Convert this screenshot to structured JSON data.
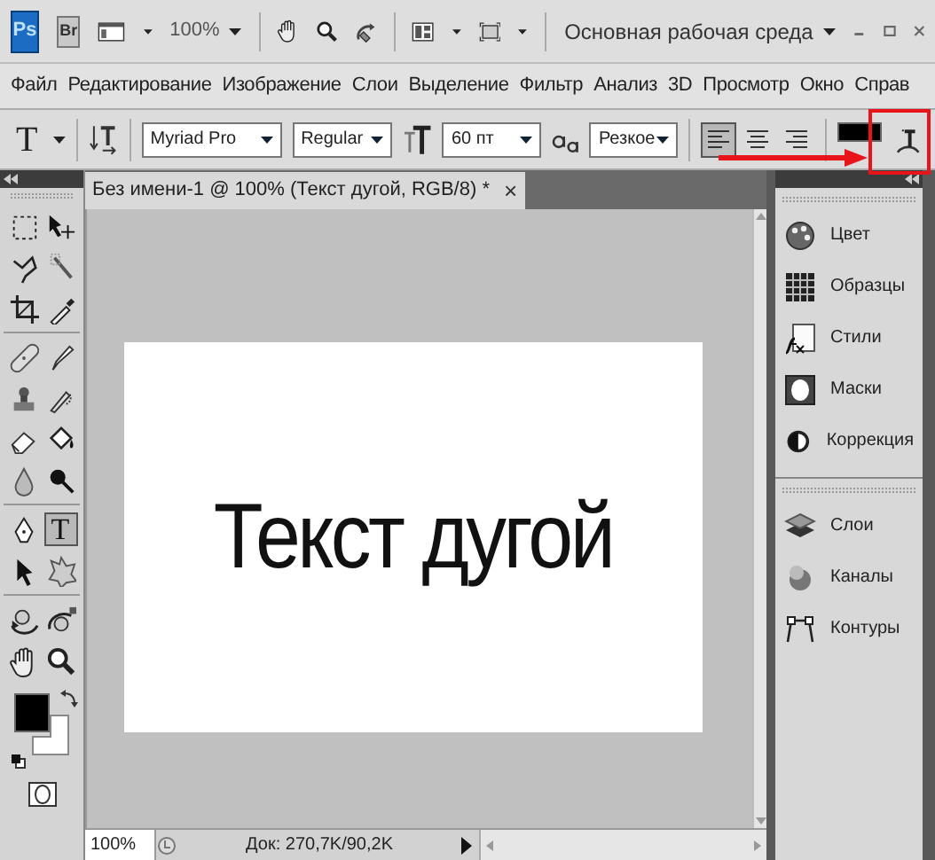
{
  "app_bar": {
    "logo": "Ps",
    "bridge": "Br",
    "zoom": "100%",
    "workspace": "Основная рабочая среда"
  },
  "menu": [
    "Файл",
    "Редактирование",
    "Изображение",
    "Слои",
    "Выделение",
    "Фильтр",
    "Анализ",
    "3D",
    "Просмотр",
    "Окно",
    "Справ"
  ],
  "options_bar": {
    "tool_glyph": "T",
    "font_family": "Myriad Pro",
    "font_style": "Regular",
    "font_size": "60 пт",
    "antialias": "Резкое",
    "align": [
      {
        "kind": "left",
        "selected": true
      },
      {
        "kind": "center",
        "selected": false
      },
      {
        "kind": "right",
        "selected": false
      }
    ]
  },
  "tool_groups": [
    [
      {
        "kind": "marquee",
        "selected": false
      },
      {
        "kind": "move",
        "selected": false
      },
      {
        "kind": "lasso",
        "selected": false
      },
      {
        "kind": "wand",
        "selected": false
      },
      {
        "kind": "crop",
        "selected": false
      },
      {
        "kind": "eyedropper",
        "selected": false
      }
    ],
    [
      {
        "kind": "healing",
        "selected": false
      },
      {
        "kind": "brush",
        "selected": false
      },
      {
        "kind": "stamp",
        "selected": false
      },
      {
        "kind": "history",
        "selected": false
      },
      {
        "kind": "eraser",
        "selected": false
      },
      {
        "kind": "bucket",
        "selected": false
      },
      {
        "kind": "blur",
        "selected": false
      },
      {
        "kind": "dodge",
        "selected": false
      }
    ],
    [
      {
        "kind": "pen",
        "selected": false
      },
      {
        "kind": "type",
        "selected": true,
        "glyph": "T"
      },
      {
        "kind": "path",
        "selected": false
      },
      {
        "kind": "shape",
        "selected": false
      }
    ],
    [
      {
        "kind": "rotate3d",
        "selected": false
      },
      {
        "kind": "orbit3d",
        "selected": false
      },
      {
        "kind": "hand",
        "selected": false
      },
      {
        "kind": "zoom",
        "selected": false
      }
    ]
  ],
  "document": {
    "tab_title": "Без имени-1 @ 100% (Текст дугой, RGB/8) *",
    "close": "×",
    "canvas_text": "Текст дугой",
    "zoom": "100%",
    "doc_info": "Док: 270,7K/90,2K"
  },
  "panels": [
    [
      {
        "kind": "color",
        "label": "Цвет"
      },
      {
        "kind": "swatches",
        "label": "Образцы"
      },
      {
        "kind": "styles",
        "label": "Стили"
      },
      {
        "kind": "masks",
        "label": "Маски"
      },
      {
        "kind": "adjust",
        "label": "Коррекция"
      }
    ],
    [
      {
        "kind": "layers",
        "label": "Слои"
      },
      {
        "kind": "channels",
        "label": "Каналы"
      },
      {
        "kind": "paths",
        "label": "Контуры"
      }
    ]
  ]
}
